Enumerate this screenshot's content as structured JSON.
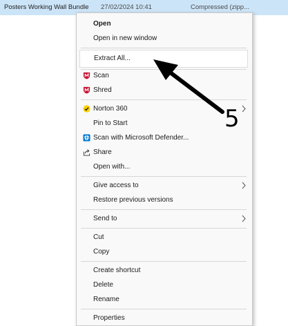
{
  "file_row": {
    "name": "Posters Working Wall Bundle",
    "date": "27/02/2024 10:41",
    "type": "Compressed (zipp..."
  },
  "menu": {
    "open": "Open",
    "open_new_window": "Open in new window",
    "extract_all": "Extract All...",
    "scan": "Scan",
    "shred": "Shred",
    "norton": "Norton 360",
    "pin_to_start": "Pin to Start",
    "scan_defender": "Scan with Microsoft Defender...",
    "share": "Share",
    "open_with": "Open with...",
    "give_access": "Give access to",
    "restore_versions": "Restore previous versions",
    "send_to": "Send to",
    "cut": "Cut",
    "copy": "Copy",
    "create_shortcut": "Create shortcut",
    "delete": "Delete",
    "rename": "Rename",
    "properties": "Properties"
  },
  "annotation": {
    "step_number": "5"
  },
  "colors": {
    "selection": "#cce4f7",
    "mcafee_red": "#c8102e",
    "norton_yellow": "#ffd200",
    "defender_blue": "#0078d4",
    "arrow": "#000000"
  },
  "icons": {
    "scan": "mcafee-shield-icon",
    "shred": "mcafee-shield-icon",
    "norton": "norton-check-icon",
    "defender": "defender-shield-icon",
    "share": "share-icon",
    "chevron": "chevron-right-icon"
  }
}
